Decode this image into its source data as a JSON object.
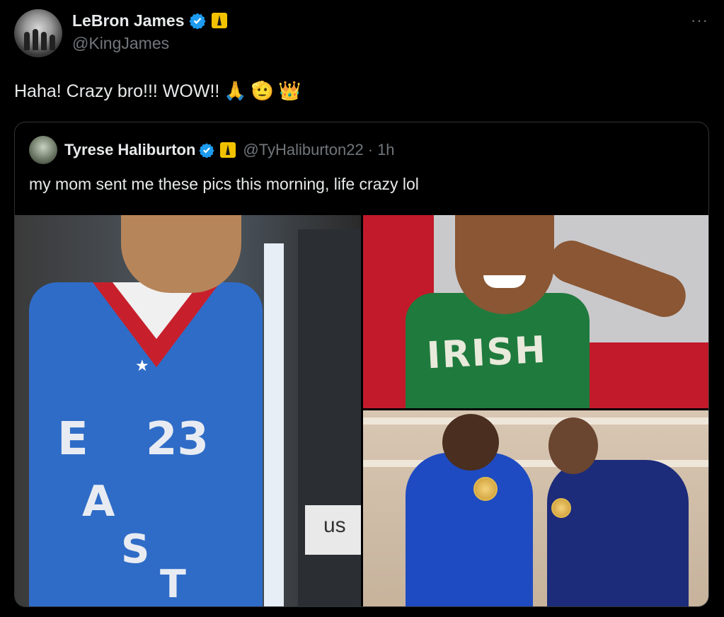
{
  "tweet": {
    "author_name": "LeBron James",
    "author_handle": "@KingJames",
    "more_glyph": "···",
    "text": "Haha! Crazy bro!!! WOW!!",
    "emojis": [
      "🙏",
      "🫡",
      "👑"
    ]
  },
  "quote": {
    "author_name": "Tyrese Haliburton",
    "author_handle": "@TyHaliburton22",
    "separator": "·",
    "time": "1h",
    "text": "my mom sent me these pics this morning, life crazy lol",
    "photo1": {
      "jersey_word": [
        "E",
        "A",
        "S",
        "T"
      ],
      "number": "23",
      "tag": "us"
    },
    "photo2": {
      "jersey_text": "IRISH"
    }
  },
  "colors": {
    "background": "#000000",
    "text": "#e7e9ea",
    "secondary": "#71767b",
    "verified": "#1d9bf0",
    "border": "#2f3336",
    "affiliate_badge": "#f2c200"
  }
}
